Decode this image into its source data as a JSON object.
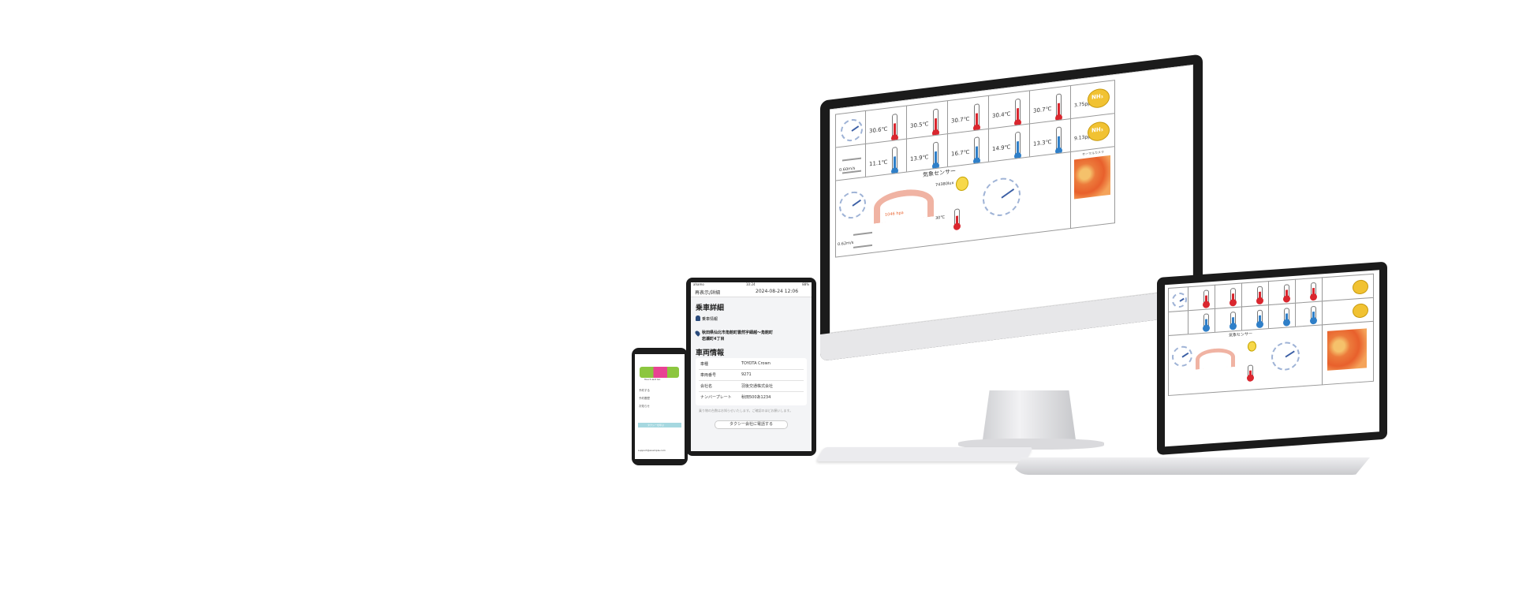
{
  "colors": {
    "hot": "#d9262e",
    "cold": "#2f7fc8",
    "gauge": "#f0b3a3",
    "heat": "#e8602c",
    "device": "#1b1b1b"
  },
  "desktop": {
    "title": "気象センサー",
    "camera_title": "サーマルカメラ",
    "temps_top": [
      "30.6℃",
      "30.5℃",
      "30.7℃",
      "30.4℃",
      "30.7℃"
    ],
    "ppm_top": "3.75ppm",
    "temps_bottom": [
      "11.1℃",
      "13.9℃",
      "16.7℃",
      "14.9℃",
      "13.3℃"
    ],
    "ppm_bottom": "9.13ppm",
    "wind_top": "0.60m/s",
    "wind_bottom": "0.62m/s",
    "gauge_value": "1046 hpa",
    "lux": "74380lux",
    "temp_small": "30℃",
    "nh_label": "NH₃"
  },
  "tablet": {
    "status_left": "ahamo",
    "status_center": "10:24",
    "status_right": "88%",
    "header_left": "再表示/詳細",
    "header_right": "2024-08-24 12:06",
    "section1": "乗車詳細",
    "passenger": "乗車情報",
    "route": "秋田県仙北市角館町雲然字細越～角館町",
    "route2": "岩瀬町4丁目",
    "section2": "車両情報",
    "rows": [
      {
        "k": "車種",
        "v": "TOYOTA Crown"
      },
      {
        "k": "車両番号",
        "v": "9271"
      },
      {
        "k": "会社名",
        "v": "羽後交通株式会社"
      },
      {
        "k": "ナンバープレート",
        "v": "秋田500あ1234"
      }
    ],
    "note": "乗り物の台数はお知らせいたします。ご確認のほどお願いします。",
    "button": "タクシー会社に電話する"
  },
  "phone": {
    "logo_text": "Touch and Go",
    "items": [
      "予約する",
      "予約履歴",
      "お知らせ"
    ],
    "action": "タクシーを呼ぶ",
    "footer": "support@example.com"
  }
}
